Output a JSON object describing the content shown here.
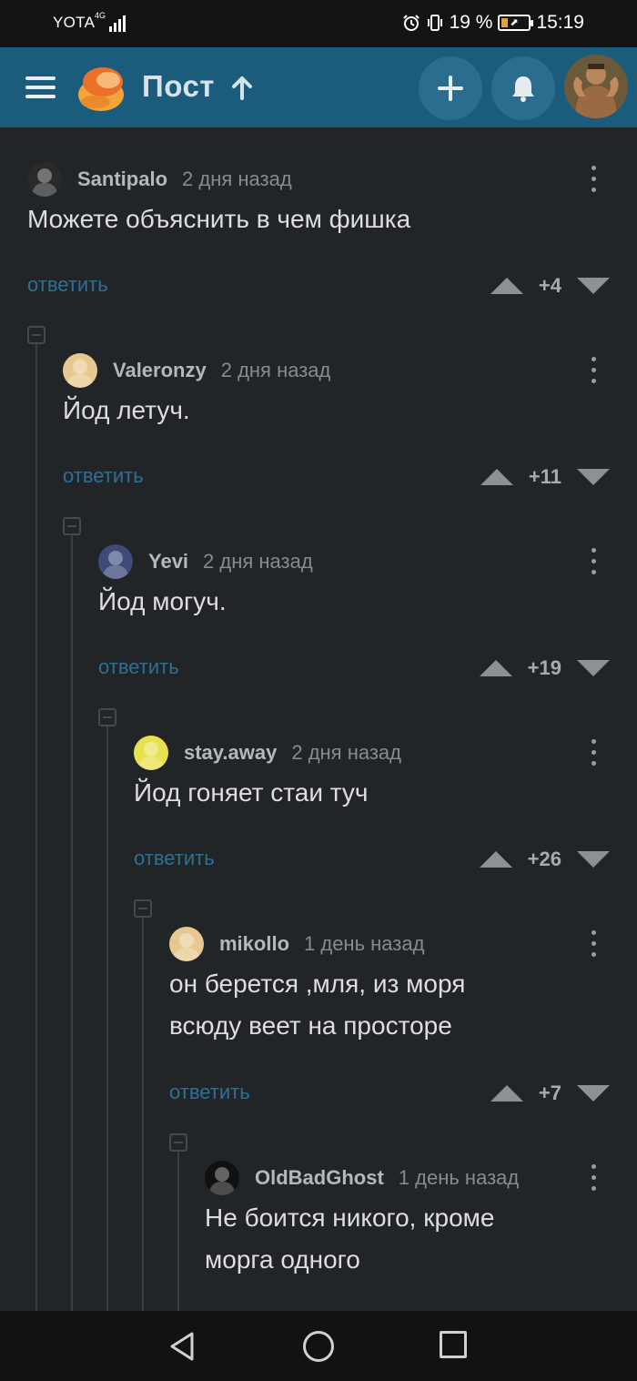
{
  "status_bar": {
    "carrier": "YOTA",
    "network_type": "4G",
    "battery_percent": "19 %",
    "time": "15:19",
    "icons": [
      "signal-icon",
      "alarm-icon",
      "vibrate-icon",
      "battery-saver-icon"
    ]
  },
  "app_bar": {
    "title": "Пост",
    "icons": [
      "menu-icon",
      "pikabu-logo",
      "arrow-up-icon",
      "plus-icon",
      "bell-icon",
      "user-avatar"
    ]
  },
  "comments": [
    {
      "author": "Santipalo",
      "time": "2 дня назад",
      "text_lines": [
        "Можете объяснить в чем фишка"
      ],
      "reply_label": "ответить",
      "rating": "+4",
      "avatar_color": "#2a2a2a"
    },
    {
      "author": "Valeronzy",
      "time": "2 дня назад",
      "text_lines": [
        "Йод летуч."
      ],
      "reply_label": "ответить",
      "rating": "+11",
      "avatar_color": "#e8c891"
    },
    {
      "author": "Yevi",
      "time": "2 дня назад",
      "text_lines": [
        "Йод могуч."
      ],
      "reply_label": "ответить",
      "rating": "+19",
      "avatar_color": "#3d4a7a"
    },
    {
      "author": "stay.away",
      "time": "2 дня назад",
      "text_lines": [
        "Йод гоняет стаи туч"
      ],
      "reply_label": "ответить",
      "rating": "+26",
      "avatar_color": "#e8e050"
    },
    {
      "author": "mikollo",
      "time": "1 день назад",
      "text_lines": [
        "он берется ,мля, из моря",
        "всюду веет на просторе"
      ],
      "reply_label": "ответить",
      "rating": "+7",
      "avatar_color": "#e8c891"
    },
    {
      "author": "OldBadGhost",
      "time": "1 день назад",
      "text_lines": [
        "Не боится никого, кроме",
        "морга одного"
      ],
      "reply_label": "",
      "rating": "",
      "avatar_color": "#111111"
    }
  ],
  "nav_bar": {
    "icons": [
      "back-icon",
      "home-icon",
      "recent-apps-icon"
    ]
  },
  "colors": {
    "background": "#222528",
    "app_bar": "#1b5c7d",
    "reply_link": "#2e7094",
    "status_bar": "#141414"
  }
}
